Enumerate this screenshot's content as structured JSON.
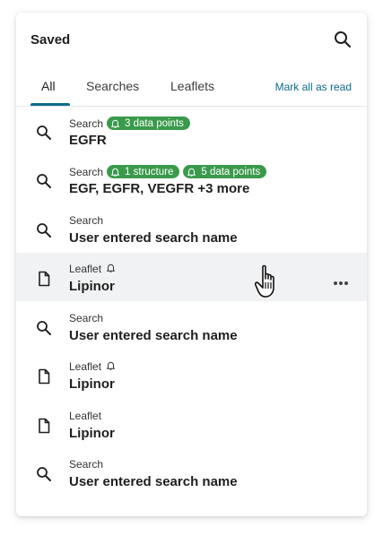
{
  "panel": {
    "title": "Saved",
    "search_icon": "search-icon"
  },
  "tabs": [
    {
      "label": "All",
      "active": true
    },
    {
      "label": "Searches",
      "active": false
    },
    {
      "label": "Leaflets",
      "active": false
    }
  ],
  "mark_all_label": "Mark all as read",
  "colors": {
    "accent": "#0a6b8a",
    "badge": "#3a9a4c",
    "hover_row": "#f1f2f3"
  },
  "items": [
    {
      "kind": "Search",
      "icon": "search-icon",
      "name": "EGFR",
      "badges": [
        "3 data points"
      ],
      "bell": false
    },
    {
      "kind": "Search",
      "icon": "search-icon",
      "name": "EGF,  EGFR, VEGFR +3 more",
      "badges": [
        "1 structure",
        "5 data points"
      ],
      "bell": false
    },
    {
      "kind": "Search",
      "icon": "search-icon",
      "name": "User entered search name",
      "badges": [],
      "bell": false
    },
    {
      "kind": "Leaflet",
      "icon": "document-icon",
      "name": "Lipinor",
      "badges": [],
      "bell": true,
      "hovered": true
    },
    {
      "kind": "Search",
      "icon": "search-icon",
      "name": "User entered search name",
      "badges": [],
      "bell": false
    },
    {
      "kind": "Leaflet",
      "icon": "document-icon",
      "name": "Lipinor",
      "badges": [],
      "bell": true
    },
    {
      "kind": "Leaflet",
      "icon": "document-icon",
      "name": "Lipinor",
      "badges": [],
      "bell": false
    },
    {
      "kind": "Search",
      "icon": "search-icon",
      "name": "User entered search name",
      "badges": [],
      "bell": false
    }
  ]
}
